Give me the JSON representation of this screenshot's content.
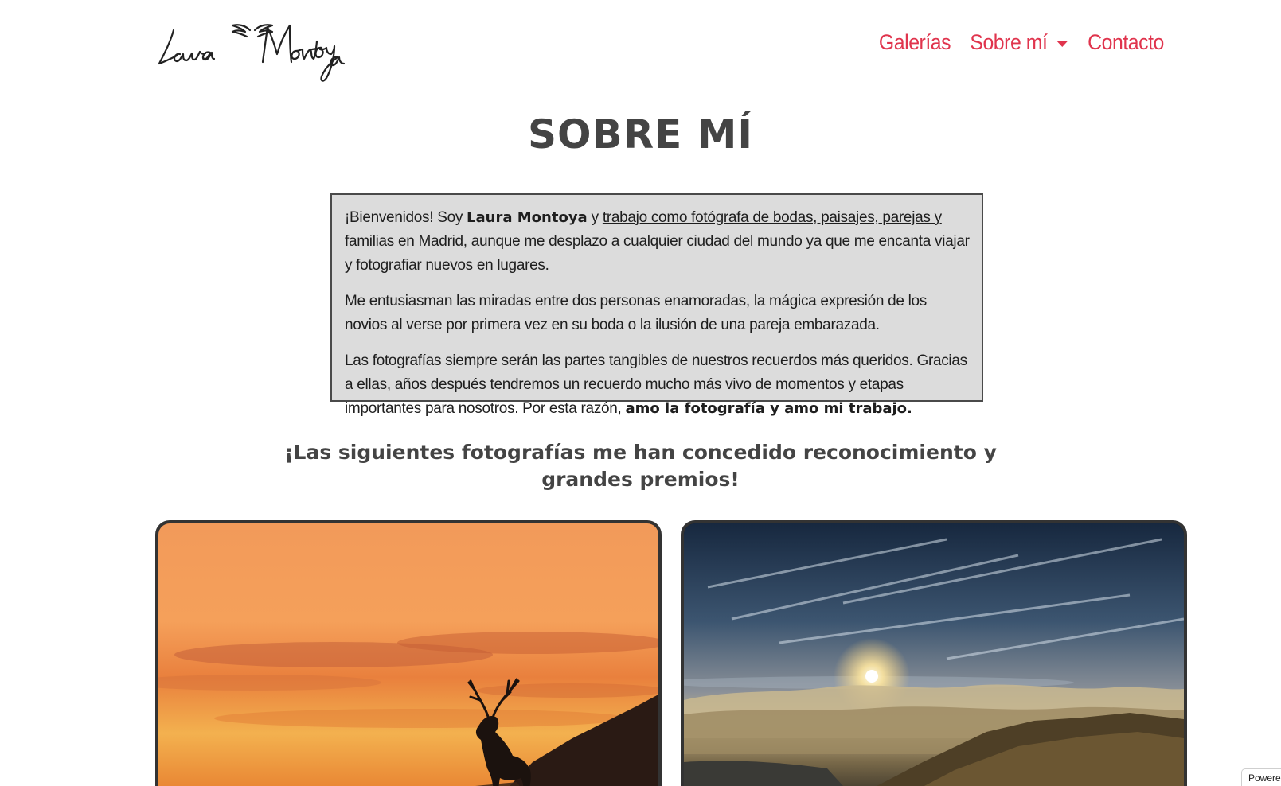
{
  "header": {
    "logo_text": "Laura Montoya",
    "nav": {
      "galerias": "Galerías",
      "sobre_mi": "Sobre mí",
      "contacto": "Contacto"
    }
  },
  "main": {
    "title": "SOBRE MÍ",
    "intro": {
      "p1_a": "¡Bienvenidos! Soy ",
      "p1_name": "Laura Montoya",
      "p1_b": " y ",
      "p1_link": "trabajo como fotógrafa de bodas, paisajes, parejas y familias",
      "p1_c": " en Madrid, aunque me desplazo a cualquier ciudad del mundo ya que me encanta viajar y fotografiar nuevos en lugares.",
      "p2": "Me entusiasman las miradas entre dos personas enamoradas, la mágica expresión de los novios al verse por primera vez en su boda o la ilusión de una pareja embarazada.",
      "p3_a": "Las fotografías siempre serán las partes tangibles de nuestros recuerdos más queridos. Gracias a ellas, años después tendremos un recuerdo mucho más vivo de momentos y etapas importantes para nosotros. Por esta razón, ",
      "p3_bold": "amo la fotografía y amo mi trabajo."
    },
    "awards_heading_line1": "¡Las siguientes fotografías me han concedido reconocimiento y",
    "awards_heading_line2": "grandes premios!"
  },
  "footer_badge": "Powered",
  "colors": {
    "nav_accent": "#e0344d",
    "heading": "#444444",
    "intro_bg": "#dcdcdc"
  }
}
